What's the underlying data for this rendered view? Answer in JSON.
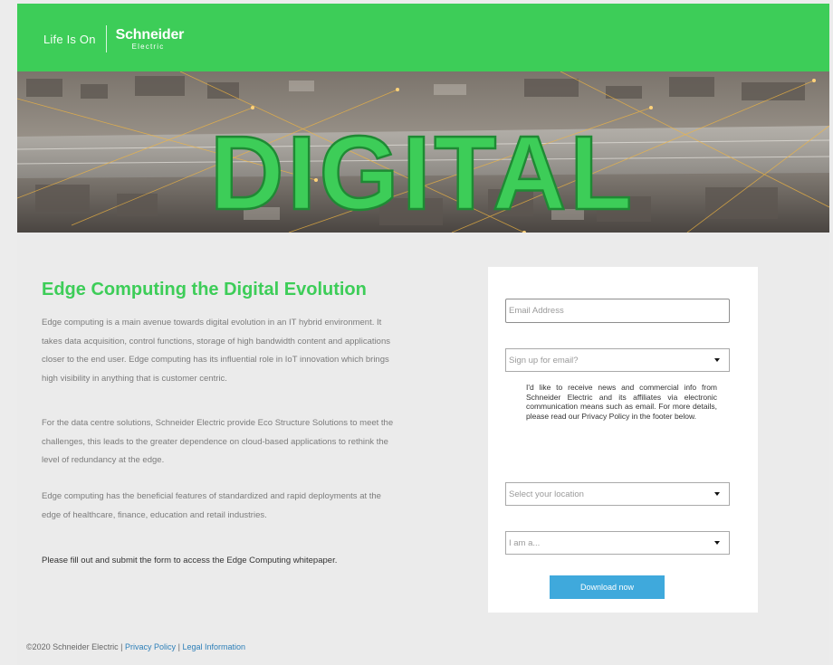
{
  "header": {
    "tagline": "Life Is On",
    "brand_name": "Schneider",
    "brand_sub": "Electric",
    "brand_color": "#3dcd58"
  },
  "hero": {
    "word": "DIGITAL"
  },
  "article": {
    "title": "Edge Computing the Digital Evolution",
    "paragraphs": [
      "Edge computing is a main avenue towards digital evolution in an IT hybrid environment. It takes data acquisition, control functions, storage of high bandwidth content and applications closer to the end user. Edge computing has its influential role in IoT innovation which brings high visibility in anything that is customer centric.",
      "For the data centre solutions, Schneider Electric provide Eco Structure Solutions to meet the challenges, this leads to the greater dependence on cloud-based applications to rethink the level of redundancy at the edge.",
      "Edge computing has the beneficial features of standardized and rapid deployments at the edge of healthcare, finance, education and retail industries."
    ],
    "cta": "Please fill out and submit the form to access the Edge Computing whitepaper."
  },
  "form": {
    "email_placeholder": "Email Address",
    "signup_placeholder": "Sign up for email?",
    "consent_text": "I'd like to receive news and commercial info from Schneider Electric and its affiliates via electronic communication means such as email. For more details, please read our Privacy Policy in the footer below.",
    "location_placeholder": "Select your location",
    "role_placeholder": "I am a...",
    "submit_label": "Download now",
    "button_color": "#3fa9dc"
  },
  "footer": {
    "copyright": "©2020 Schneider Electric |",
    "privacy_link": "Privacy Policy",
    "separator": "|",
    "legal_link": "Legal Information"
  }
}
